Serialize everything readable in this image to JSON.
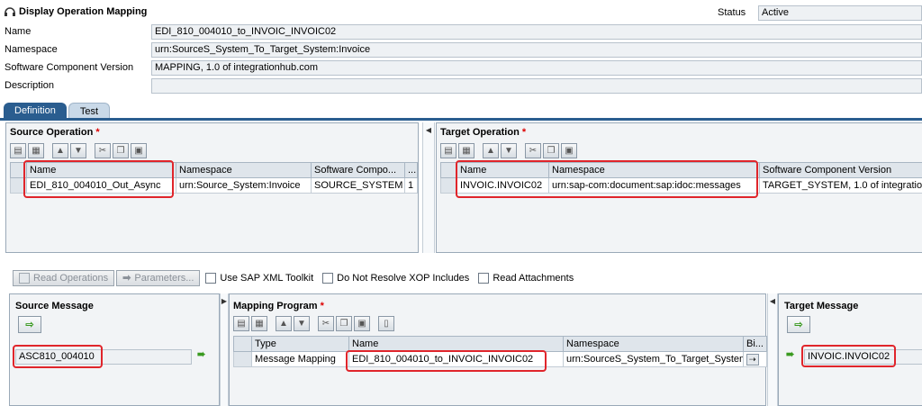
{
  "header": {
    "title": "Display Operation Mapping",
    "status_label": "Status",
    "status_value": "Active"
  },
  "form": {
    "name_label": "Name",
    "name_value": "EDI_810_004010_to_INVOIC_INVOIC02",
    "namespace_label": "Namespace",
    "namespace_value": "urn:SourceS_System_To_Target_System:Invoice",
    "scv_label": "Software Component Version",
    "scv_value": "MAPPING, 1.0 of integrationhub.com",
    "description_label": "Description",
    "description_value": ""
  },
  "tabs": [
    {
      "label": "Definition",
      "active": true
    },
    {
      "label": "Test",
      "active": false
    }
  ],
  "source_operation": {
    "title": "Source Operation",
    "required_mark": "*",
    "columns": [
      "Name",
      "Namespace",
      "Software Compo...",
      "..."
    ],
    "rows": [
      [
        "EDI_810_004010_Out_Async",
        "urn:Source_System:Invoice",
        "SOURCE_SYSTEM",
        "1"
      ]
    ]
  },
  "target_operation": {
    "title": "Target Operation",
    "required_mark": "*",
    "columns": [
      "Name",
      "Namespace",
      "Software Component Version"
    ],
    "rows": [
      [
        "INVOIC.INVOIC02",
        "urn:sap-com:document:sap:idoc:messages",
        "TARGET_SYSTEM, 1.0 of integratio"
      ]
    ]
  },
  "actions": {
    "read_operations": "Read Operations",
    "parameters": "Parameters...",
    "use_xml_toolkit": "Use SAP XML Toolkit",
    "no_resolve_xop": "Do Not Resolve XOP Includes",
    "read_attachments": "Read Attachments"
  },
  "source_message": {
    "title": "Source Message",
    "value": "ASC810_004010"
  },
  "mapping_program": {
    "title": "Mapping Program",
    "required_mark": "*",
    "columns": [
      "Type",
      "Name",
      "Namespace",
      "Bi..."
    ],
    "rows": [
      [
        "Message Mapping",
        "EDI_810_004010_to_INVOIC_INVOIC02",
        "urn:SourceS_System_To_Target_System",
        ""
      ]
    ]
  },
  "target_message": {
    "title": "Target Message",
    "value": "INVOIC.INVOIC02"
  },
  "colors": {
    "tab_active": "#2a5d8f",
    "highlight": "#e0252b",
    "required": "#dd0000"
  }
}
